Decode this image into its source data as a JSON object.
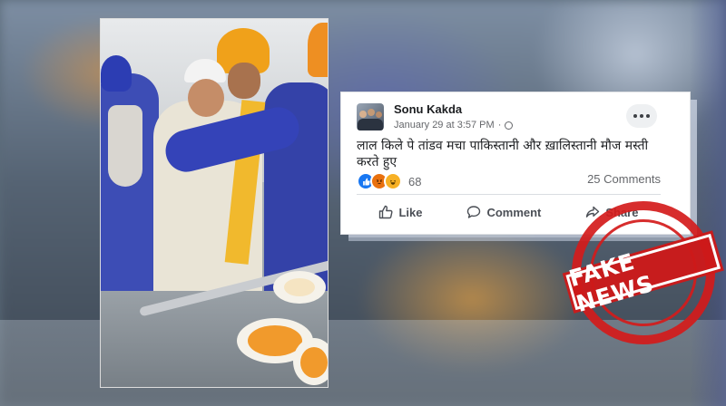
{
  "post": {
    "author": "Sonu Kakda",
    "timestamp": "January 29 at 3:57 PM",
    "separator": "·",
    "privacy_icon": "globe-icon",
    "text": "लाल किले पे तांडव मचा पाकिस्तानी और ख़ालिस्तानी मौज मस्ती करते हुए",
    "reaction_count": "68",
    "comments_count": "25 Comments",
    "actions": {
      "like": "Like",
      "comment": "Comment",
      "share": "Share"
    },
    "reactions": [
      "like",
      "angry",
      "haha"
    ]
  },
  "stamp": {
    "label": "FAKE NEWS",
    "color": "#d41b1b"
  },
  "colors": {
    "facebook_blue": "#1877f2",
    "text_primary": "#1c1e21",
    "text_secondary": "#65676b"
  }
}
